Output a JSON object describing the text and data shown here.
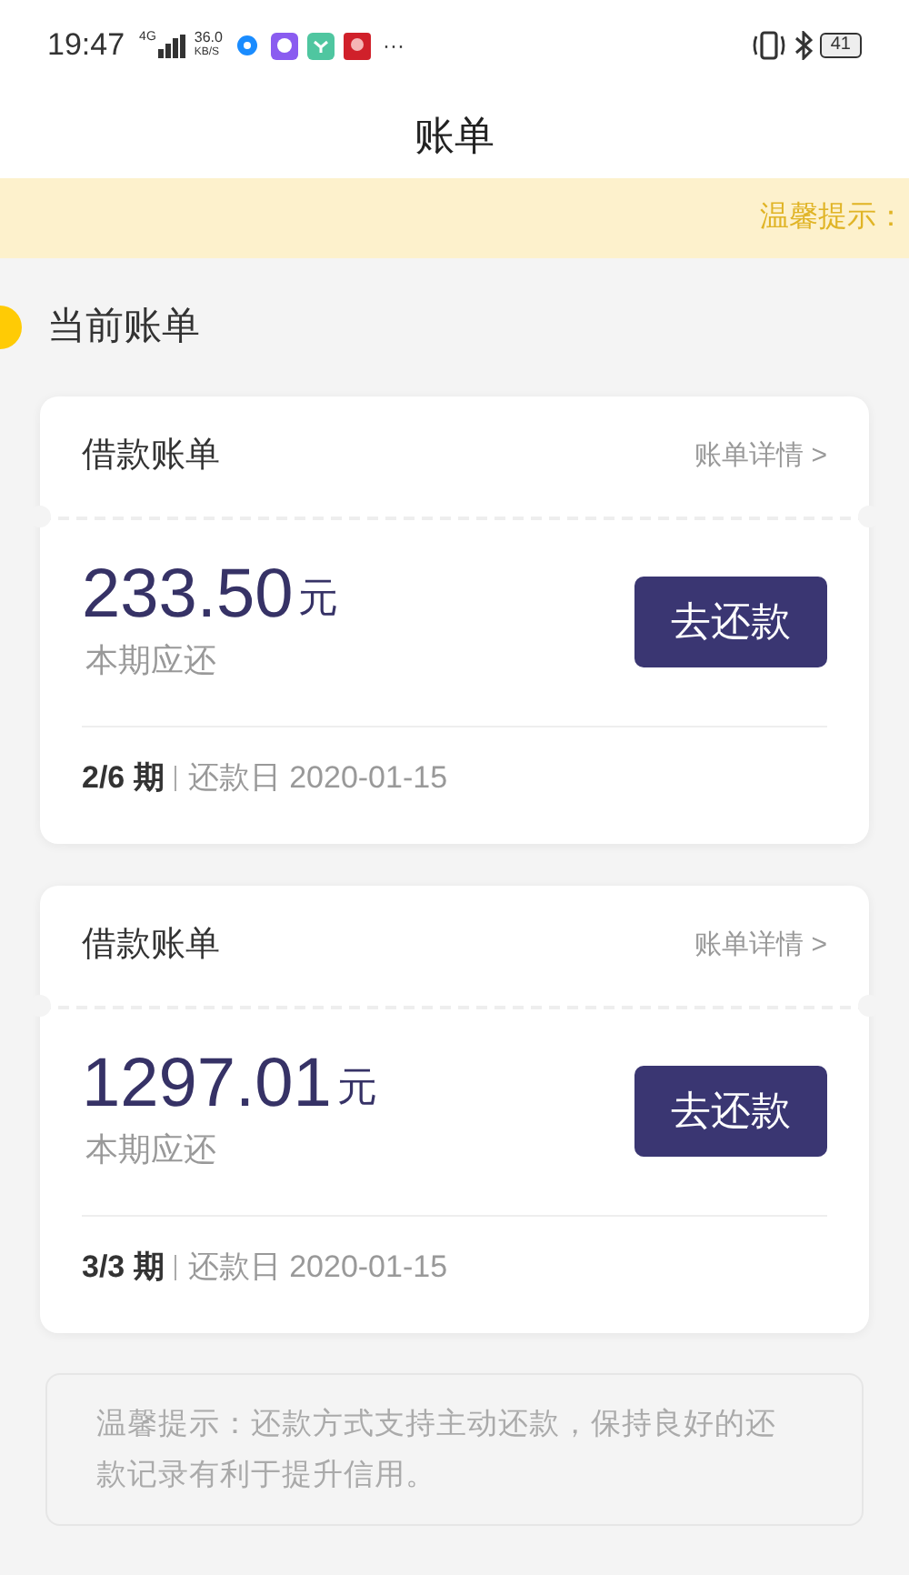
{
  "status_bar": {
    "time": "19:47",
    "network": "4G",
    "speed": "36.0",
    "speed_unit": "KB/S",
    "more": "···",
    "battery": "41"
  },
  "header": {
    "title": "账单"
  },
  "notice_banner": {
    "text": "温馨提示："
  },
  "section": {
    "title": "当前账单"
  },
  "bills": [
    {
      "title": "借款账单",
      "detail_link": "账单详情 >",
      "amount": "233.50",
      "unit": "元",
      "amount_label": "本期应还",
      "button": "去还款",
      "period": "2/6 期",
      "due_date": "还款日 2020-01-15"
    },
    {
      "title": "借款账单",
      "detail_link": "账单详情 >",
      "amount": "1297.01",
      "unit": "元",
      "amount_label": "本期应还",
      "button": "去还款",
      "period": "3/3 期",
      "due_date": "还款日 2020-01-15"
    }
  ],
  "tip": {
    "text": "温馨提示：还款方式支持主动还款，保持良好的还款记录有利于提升信用。"
  }
}
